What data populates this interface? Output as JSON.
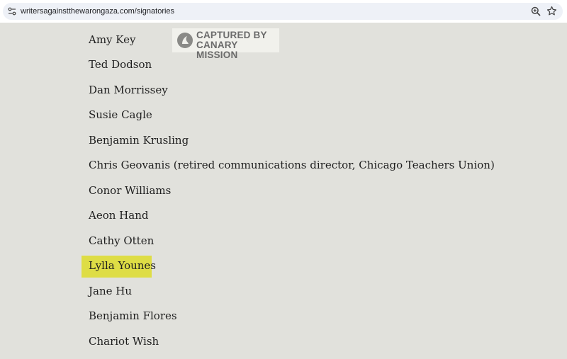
{
  "browser": {
    "url": "writersagainstthewarongaza.com/signatories",
    "icons": [
      "tune-icon",
      "zoom-icon",
      "star-icon"
    ]
  },
  "watermark": {
    "line1": "CAPTURED BY",
    "line2": "CANARY MISSION"
  },
  "highlight_color": "#dedd45",
  "signatories": [
    "Amy Key",
    "Ted Dodson",
    "Dan Morrissey",
    "Susie Cagle",
    "Benjamin Krusling",
    "Chris Geovanis (retired communications director, Chicago Teachers Union)",
    "Conor Williams",
    "Aeon Hand",
    "Cathy Otten",
    "Lylla Younes",
    "Jane Hu",
    "Benjamin Flores",
    "Chariot Wish"
  ],
  "highlighted_signatory": "Lylla Younes"
}
